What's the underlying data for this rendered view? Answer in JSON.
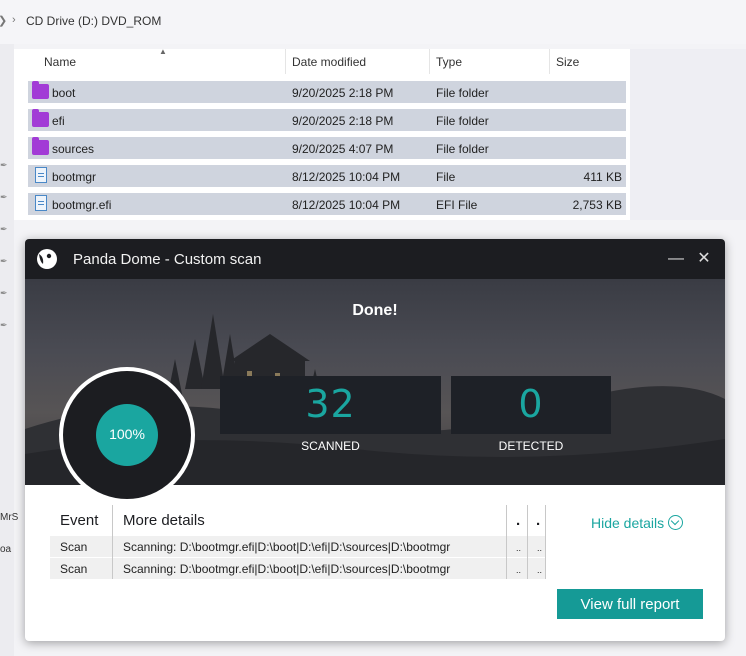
{
  "explorer": {
    "breadcrumb": "CD Drive (D:) DVD_ROM",
    "columns": {
      "name": "Name",
      "date": "Date modified",
      "type": "Type",
      "size": "Size"
    },
    "files": [
      {
        "name": "boot",
        "date": "9/20/2025 2:18 PM",
        "type": "File folder",
        "size": "",
        "icon": "folder-icon"
      },
      {
        "name": "efi",
        "date": "9/20/2025 2:18 PM",
        "type": "File folder",
        "size": "",
        "icon": "folder-icon"
      },
      {
        "name": "sources",
        "date": "9/20/2025 4:07 PM",
        "type": "File folder",
        "size": "",
        "icon": "folder-icon"
      },
      {
        "name": "bootmgr",
        "date": "8/12/2025 10:04 PM",
        "type": "File",
        "size": "411 KB",
        "icon": "file-icon"
      },
      {
        "name": "bootmgr.efi",
        "date": "8/12/2025 10:04 PM",
        "type": "EFI File",
        "size": "2,753 KB",
        "icon": "file-icon"
      }
    ],
    "side_fragments": [
      "MrS",
      "oa"
    ]
  },
  "panda": {
    "title": "Panda Dome - Custom scan",
    "status": "Done!",
    "progress_label": "100%",
    "progress_fraction": 1.0,
    "scanned": {
      "value": "32",
      "label": "SCANNED"
    },
    "detected": {
      "value": "0",
      "label": "DETECTED"
    },
    "table": {
      "headers": {
        "event": "Event",
        "details": "More details",
        "c3": ".",
        "c4": "."
      },
      "rows": [
        {
          "event": "Scan",
          "details": "Scanning: D:\\bootmgr.efi|D:\\boot|D:\\efi|D:\\sources|D:\\bootmgr",
          "c3": "..",
          "c4": ".."
        },
        {
          "event": "Scan",
          "details": "Scanning: D:\\bootmgr.efi|D:\\boot|D:\\efi|D:\\sources|D:\\bootmgr",
          "c3": "..",
          "c4": ".."
        }
      ]
    },
    "hide_details": "Hide details",
    "view_report": "View full report",
    "colors": {
      "accent": "#1aa6a0",
      "titlebar": "#1c1d21",
      "button": "#159a96"
    }
  }
}
